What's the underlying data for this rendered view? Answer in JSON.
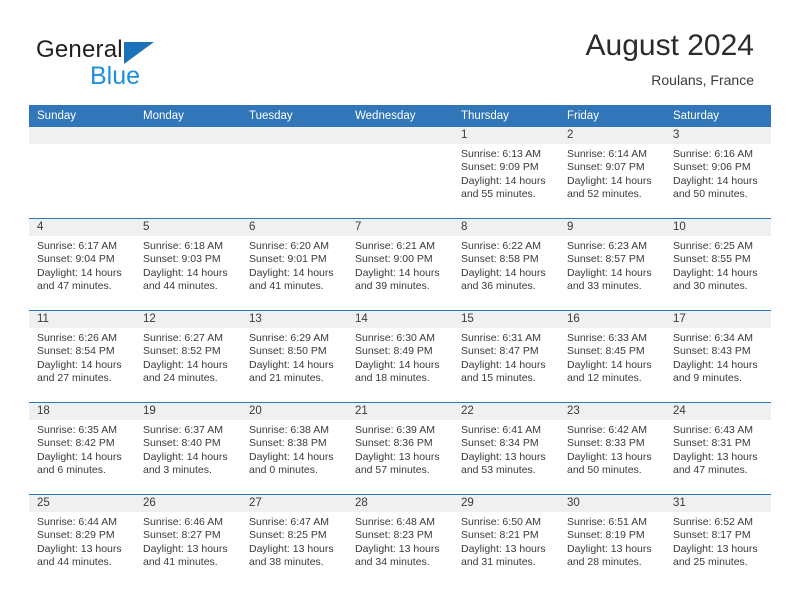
{
  "brand": {
    "word_one": "General",
    "word_two": "Blue",
    "triangle_icon": "triangle-logo-icon"
  },
  "header": {
    "title": "August 2024",
    "location": "Roulans, France"
  },
  "calendar": {
    "weekday_headers": [
      "Sunday",
      "Monday",
      "Tuesday",
      "Wednesday",
      "Thursday",
      "Friday",
      "Saturday"
    ],
    "accent_color": "#3076b8",
    "daynum_band_color": "#f0f0f0",
    "weeks": [
      [
        {
          "day": "",
          "empty": true
        },
        {
          "day": "",
          "empty": true
        },
        {
          "day": "",
          "empty": true
        },
        {
          "day": "",
          "empty": true
        },
        {
          "day": "1",
          "sunrise": "Sunrise: 6:13 AM",
          "sunset": "Sunset: 9:09 PM",
          "daylight_a": "Daylight: 14 hours",
          "daylight_b": "and 55 minutes."
        },
        {
          "day": "2",
          "sunrise": "Sunrise: 6:14 AM",
          "sunset": "Sunset: 9:07 PM",
          "daylight_a": "Daylight: 14 hours",
          "daylight_b": "and 52 minutes."
        },
        {
          "day": "3",
          "sunrise": "Sunrise: 6:16 AM",
          "sunset": "Sunset: 9:06 PM",
          "daylight_a": "Daylight: 14 hours",
          "daylight_b": "and 50 minutes."
        }
      ],
      [
        {
          "day": "4",
          "sunrise": "Sunrise: 6:17 AM",
          "sunset": "Sunset: 9:04 PM",
          "daylight_a": "Daylight: 14 hours",
          "daylight_b": "and 47 minutes."
        },
        {
          "day": "5",
          "sunrise": "Sunrise: 6:18 AM",
          "sunset": "Sunset: 9:03 PM",
          "daylight_a": "Daylight: 14 hours",
          "daylight_b": "and 44 minutes."
        },
        {
          "day": "6",
          "sunrise": "Sunrise: 6:20 AM",
          "sunset": "Sunset: 9:01 PM",
          "daylight_a": "Daylight: 14 hours",
          "daylight_b": "and 41 minutes."
        },
        {
          "day": "7",
          "sunrise": "Sunrise: 6:21 AM",
          "sunset": "Sunset: 9:00 PM",
          "daylight_a": "Daylight: 14 hours",
          "daylight_b": "and 39 minutes."
        },
        {
          "day": "8",
          "sunrise": "Sunrise: 6:22 AM",
          "sunset": "Sunset: 8:58 PM",
          "daylight_a": "Daylight: 14 hours",
          "daylight_b": "and 36 minutes."
        },
        {
          "day": "9",
          "sunrise": "Sunrise: 6:23 AM",
          "sunset": "Sunset: 8:57 PM",
          "daylight_a": "Daylight: 14 hours",
          "daylight_b": "and 33 minutes."
        },
        {
          "day": "10",
          "sunrise": "Sunrise: 6:25 AM",
          "sunset": "Sunset: 8:55 PM",
          "daylight_a": "Daylight: 14 hours",
          "daylight_b": "and 30 minutes."
        }
      ],
      [
        {
          "day": "11",
          "sunrise": "Sunrise: 6:26 AM",
          "sunset": "Sunset: 8:54 PM",
          "daylight_a": "Daylight: 14 hours",
          "daylight_b": "and 27 minutes."
        },
        {
          "day": "12",
          "sunrise": "Sunrise: 6:27 AM",
          "sunset": "Sunset: 8:52 PM",
          "daylight_a": "Daylight: 14 hours",
          "daylight_b": "and 24 minutes."
        },
        {
          "day": "13",
          "sunrise": "Sunrise: 6:29 AM",
          "sunset": "Sunset: 8:50 PM",
          "daylight_a": "Daylight: 14 hours",
          "daylight_b": "and 21 minutes."
        },
        {
          "day": "14",
          "sunrise": "Sunrise: 6:30 AM",
          "sunset": "Sunset: 8:49 PM",
          "daylight_a": "Daylight: 14 hours",
          "daylight_b": "and 18 minutes."
        },
        {
          "day": "15",
          "sunrise": "Sunrise: 6:31 AM",
          "sunset": "Sunset: 8:47 PM",
          "daylight_a": "Daylight: 14 hours",
          "daylight_b": "and 15 minutes."
        },
        {
          "day": "16",
          "sunrise": "Sunrise: 6:33 AM",
          "sunset": "Sunset: 8:45 PM",
          "daylight_a": "Daylight: 14 hours",
          "daylight_b": "and 12 minutes."
        },
        {
          "day": "17",
          "sunrise": "Sunrise: 6:34 AM",
          "sunset": "Sunset: 8:43 PM",
          "daylight_a": "Daylight: 14 hours",
          "daylight_b": "and 9 minutes."
        }
      ],
      [
        {
          "day": "18",
          "sunrise": "Sunrise: 6:35 AM",
          "sunset": "Sunset: 8:42 PM",
          "daylight_a": "Daylight: 14 hours",
          "daylight_b": "and 6 minutes."
        },
        {
          "day": "19",
          "sunrise": "Sunrise: 6:37 AM",
          "sunset": "Sunset: 8:40 PM",
          "daylight_a": "Daylight: 14 hours",
          "daylight_b": "and 3 minutes."
        },
        {
          "day": "20",
          "sunrise": "Sunrise: 6:38 AM",
          "sunset": "Sunset: 8:38 PM",
          "daylight_a": "Daylight: 14 hours",
          "daylight_b": "and 0 minutes."
        },
        {
          "day": "21",
          "sunrise": "Sunrise: 6:39 AM",
          "sunset": "Sunset: 8:36 PM",
          "daylight_a": "Daylight: 13 hours",
          "daylight_b": "and 57 minutes."
        },
        {
          "day": "22",
          "sunrise": "Sunrise: 6:41 AM",
          "sunset": "Sunset: 8:34 PM",
          "daylight_a": "Daylight: 13 hours",
          "daylight_b": "and 53 minutes."
        },
        {
          "day": "23",
          "sunrise": "Sunrise: 6:42 AM",
          "sunset": "Sunset: 8:33 PM",
          "daylight_a": "Daylight: 13 hours",
          "daylight_b": "and 50 minutes."
        },
        {
          "day": "24",
          "sunrise": "Sunrise: 6:43 AM",
          "sunset": "Sunset: 8:31 PM",
          "daylight_a": "Daylight: 13 hours",
          "daylight_b": "and 47 minutes."
        }
      ],
      [
        {
          "day": "25",
          "sunrise": "Sunrise: 6:44 AM",
          "sunset": "Sunset: 8:29 PM",
          "daylight_a": "Daylight: 13 hours",
          "daylight_b": "and 44 minutes."
        },
        {
          "day": "26",
          "sunrise": "Sunrise: 6:46 AM",
          "sunset": "Sunset: 8:27 PM",
          "daylight_a": "Daylight: 13 hours",
          "daylight_b": "and 41 minutes."
        },
        {
          "day": "27",
          "sunrise": "Sunrise: 6:47 AM",
          "sunset": "Sunset: 8:25 PM",
          "daylight_a": "Daylight: 13 hours",
          "daylight_b": "and 38 minutes."
        },
        {
          "day": "28",
          "sunrise": "Sunrise: 6:48 AM",
          "sunset": "Sunset: 8:23 PM",
          "daylight_a": "Daylight: 13 hours",
          "daylight_b": "and 34 minutes."
        },
        {
          "day": "29",
          "sunrise": "Sunrise: 6:50 AM",
          "sunset": "Sunset: 8:21 PM",
          "daylight_a": "Daylight: 13 hours",
          "daylight_b": "and 31 minutes."
        },
        {
          "day": "30",
          "sunrise": "Sunrise: 6:51 AM",
          "sunset": "Sunset: 8:19 PM",
          "daylight_a": "Daylight: 13 hours",
          "daylight_b": "and 28 minutes."
        },
        {
          "day": "31",
          "sunrise": "Sunrise: 6:52 AM",
          "sunset": "Sunset: 8:17 PM",
          "daylight_a": "Daylight: 13 hours",
          "daylight_b": "and 25 minutes."
        }
      ]
    ]
  }
}
